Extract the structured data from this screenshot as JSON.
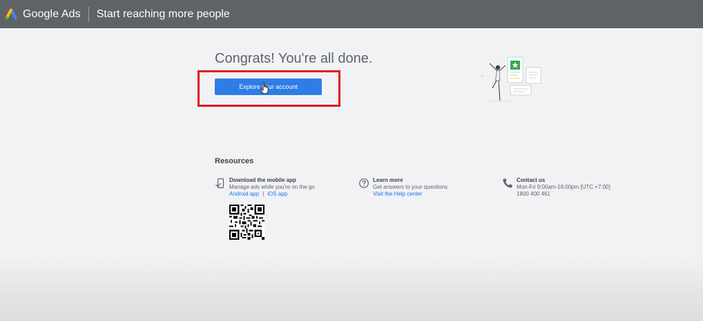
{
  "header": {
    "brand": "Google Ads",
    "page_title": "Start reaching more people",
    "bg_color": "#5f6368"
  },
  "main": {
    "heading": "Congrats! You're all done.",
    "cta_label": "Explore your account",
    "cta_color": "#2e7ce6",
    "highlight_color": "#e3101b"
  },
  "resources": {
    "title": "Resources",
    "mobile": {
      "title": "Download the mobile app",
      "desc": "Manage ads while you're on the go",
      "android_link": "Android app",
      "separator": "|",
      "ios_link": "iOS app",
      "icon": "mobile-phone-icon"
    },
    "learn": {
      "title": "Learn more",
      "desc": "Get answers to your questions",
      "link": "Visit the Help center",
      "icon": "help-circle-icon"
    },
    "contact": {
      "title": "Contact us",
      "hours": "Mon-Fri 9:00am-18:00pm [UTC +7:00]",
      "phone": "1800 400 461",
      "icon": "phone-icon"
    }
  }
}
